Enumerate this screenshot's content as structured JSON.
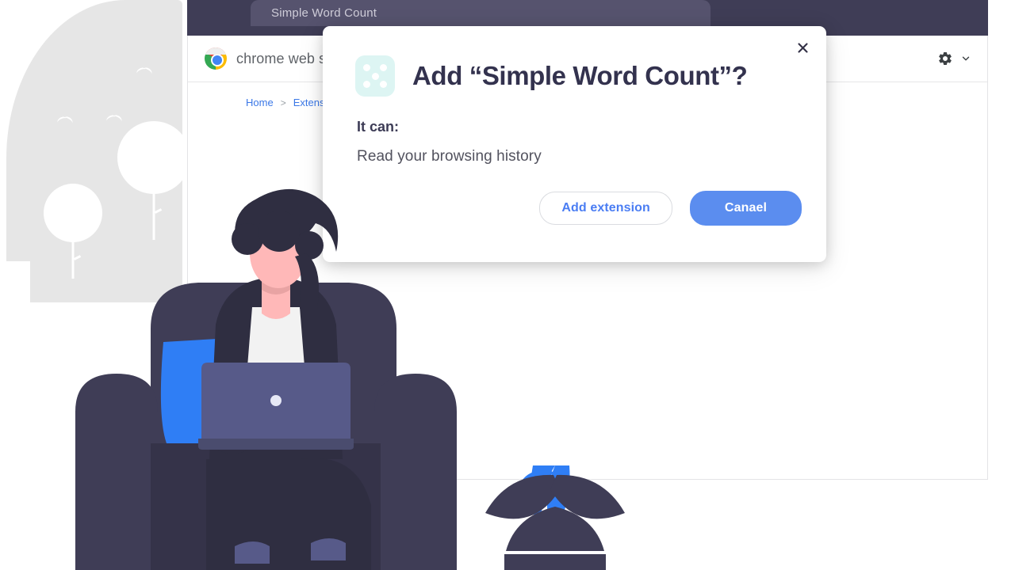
{
  "browser": {
    "tab": {
      "title": "Simple Word Count"
    }
  },
  "store_header": {
    "brand_name": "chrome web store",
    "logo_icon": "chrome-logo-icon",
    "settings_icon": "gear-icon",
    "chevron_icon": "chevron-down-icon"
  },
  "breadcrumb": {
    "items": [
      {
        "label": "Home"
      },
      {
        "label": "Extensions"
      }
    ],
    "separator": ">"
  },
  "dialog": {
    "close_icon": "close-icon",
    "extension_icon": "extension-dice-icon",
    "title": "Add “Simple Word Count”?",
    "subtitle": "It can:",
    "permissions": [
      "Read your browsing history"
    ],
    "buttons": {
      "secondary_label": "Add extension",
      "primary_label": "Canael"
    }
  },
  "colors": {
    "chrome_bar": "#3f3d56",
    "tab_background": "#56536e",
    "primary_button": "#5b8def",
    "secondary_text": "#4a7df3",
    "extension_icon_bg": "#ddf5f3",
    "illustration_dark": "#3f3d56",
    "illustration_blue": "#2f7ef5",
    "skin": "#ffb8b8"
  },
  "illustration": {
    "background_window": "window-shape",
    "trees": 2,
    "birds": 3,
    "person": "person-with-laptop",
    "chair": "armchair",
    "plant": "potted-plant"
  }
}
